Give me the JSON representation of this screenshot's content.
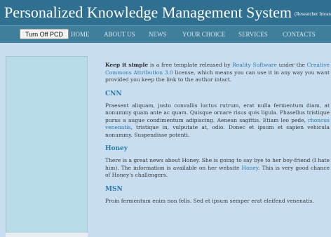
{
  "header": {
    "title": "Personalized Knowledge Management System",
    "subtitle": "(Researcher Imran Ohani)"
  },
  "nav": {
    "pcd_button": "Turn Off PCD",
    "items": [
      "HOME",
      "ABOUT US",
      "NEWS",
      "YOUR CHOICE",
      "SERVICES",
      "CONTACTS"
    ]
  },
  "content": {
    "intro": {
      "bold": "Keep it simple",
      "t1": " is a free template released by ",
      "link1": "Reality Software",
      "t2": " under the ",
      "link2": "Creative Commons Attribution 3.0",
      "t3": " license, which means you can use it in any way you want provided you keep the link to the author intact."
    },
    "cnn": {
      "heading": "CNN",
      "t1": "Praesent aliquam, justo convallis luctus rutrum, erat nulla fermentum diam, at nonummy quam ante ac quam. Quisque ornare risus quis ligula. Phasellus tristique purus a augue condimentum adipiscing. Aenean sagittis. Etiam leo pede, ",
      "link": "rhoncus venenatis",
      "t2": ", tristique in, vulputate at, odio. Donec et ipsum et sapien vehicula nonummy. Suspendisse potenti."
    },
    "honey": {
      "heading": "Honey",
      "t1": "There is a great news about Honey. She is going to say bye to her boy-friend (I hate him). The information is available on her website ",
      "link": "Honey",
      "t2": ". This is very good chance of Honey's challengers."
    },
    "msn": {
      "heading": "MSN",
      "text": "Proin fermentum enim non felis. Sed et ipsum semper erat eleifend venenatis."
    }
  },
  "colors": {
    "header_bg": "#2f6f8f",
    "nav_bg": "#3f7f9b",
    "page_bg": "#c9ddf0",
    "sidebar_bg": "#b8dbe8",
    "link": "#2a79a8"
  }
}
